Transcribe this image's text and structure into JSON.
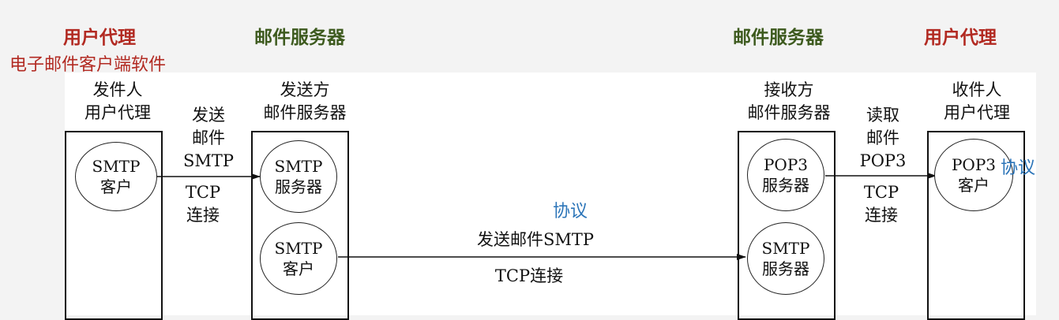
{
  "headers": {
    "left_agent": "用户代理",
    "left_agent_sub": "电子邮件客户端软件",
    "left_server": "邮件服务器",
    "right_server": "邮件服务器",
    "right_agent": "用户代理"
  },
  "boxes": {
    "sender_agent": {
      "title_line1": "发件人",
      "title_line2": "用户代理"
    },
    "sender_server": {
      "title_line1": "发送方",
      "title_line2": "邮件服务器"
    },
    "receiver_server": {
      "title_line1": "接收方",
      "title_line2": "邮件服务器"
    },
    "receiver_agent": {
      "title_line1": "收件人",
      "title_line2": "用户代理"
    }
  },
  "circles": {
    "smtp_client_1": {
      "line1": "SMTP",
      "line2": "客户"
    },
    "smtp_server_1": {
      "line1": "SMTP",
      "line2": "服务器"
    },
    "smtp_client_2": {
      "line1": "SMTP",
      "line2": "客户"
    },
    "pop3_server": {
      "line1": "POP3",
      "line2": "服务器"
    },
    "smtp_server_2": {
      "line1": "SMTP",
      "line2": "服务器"
    },
    "pop3_client": {
      "line1": "POP3",
      "line2": "客户"
    }
  },
  "links": {
    "send": {
      "line1": "发送",
      "line2": "邮件",
      "line3": "SMTP",
      "line4": "TCP",
      "line5": "连接"
    },
    "read": {
      "line1": "读取",
      "line2": "邮件",
      "line3": "POP3",
      "line4": "TCP",
      "line5": "连接"
    },
    "middle_top": "发送邮件SMTP",
    "middle_bottom": "TCP连接"
  },
  "annotations": {
    "protocol_middle": "协议",
    "protocol_right": "协议"
  }
}
